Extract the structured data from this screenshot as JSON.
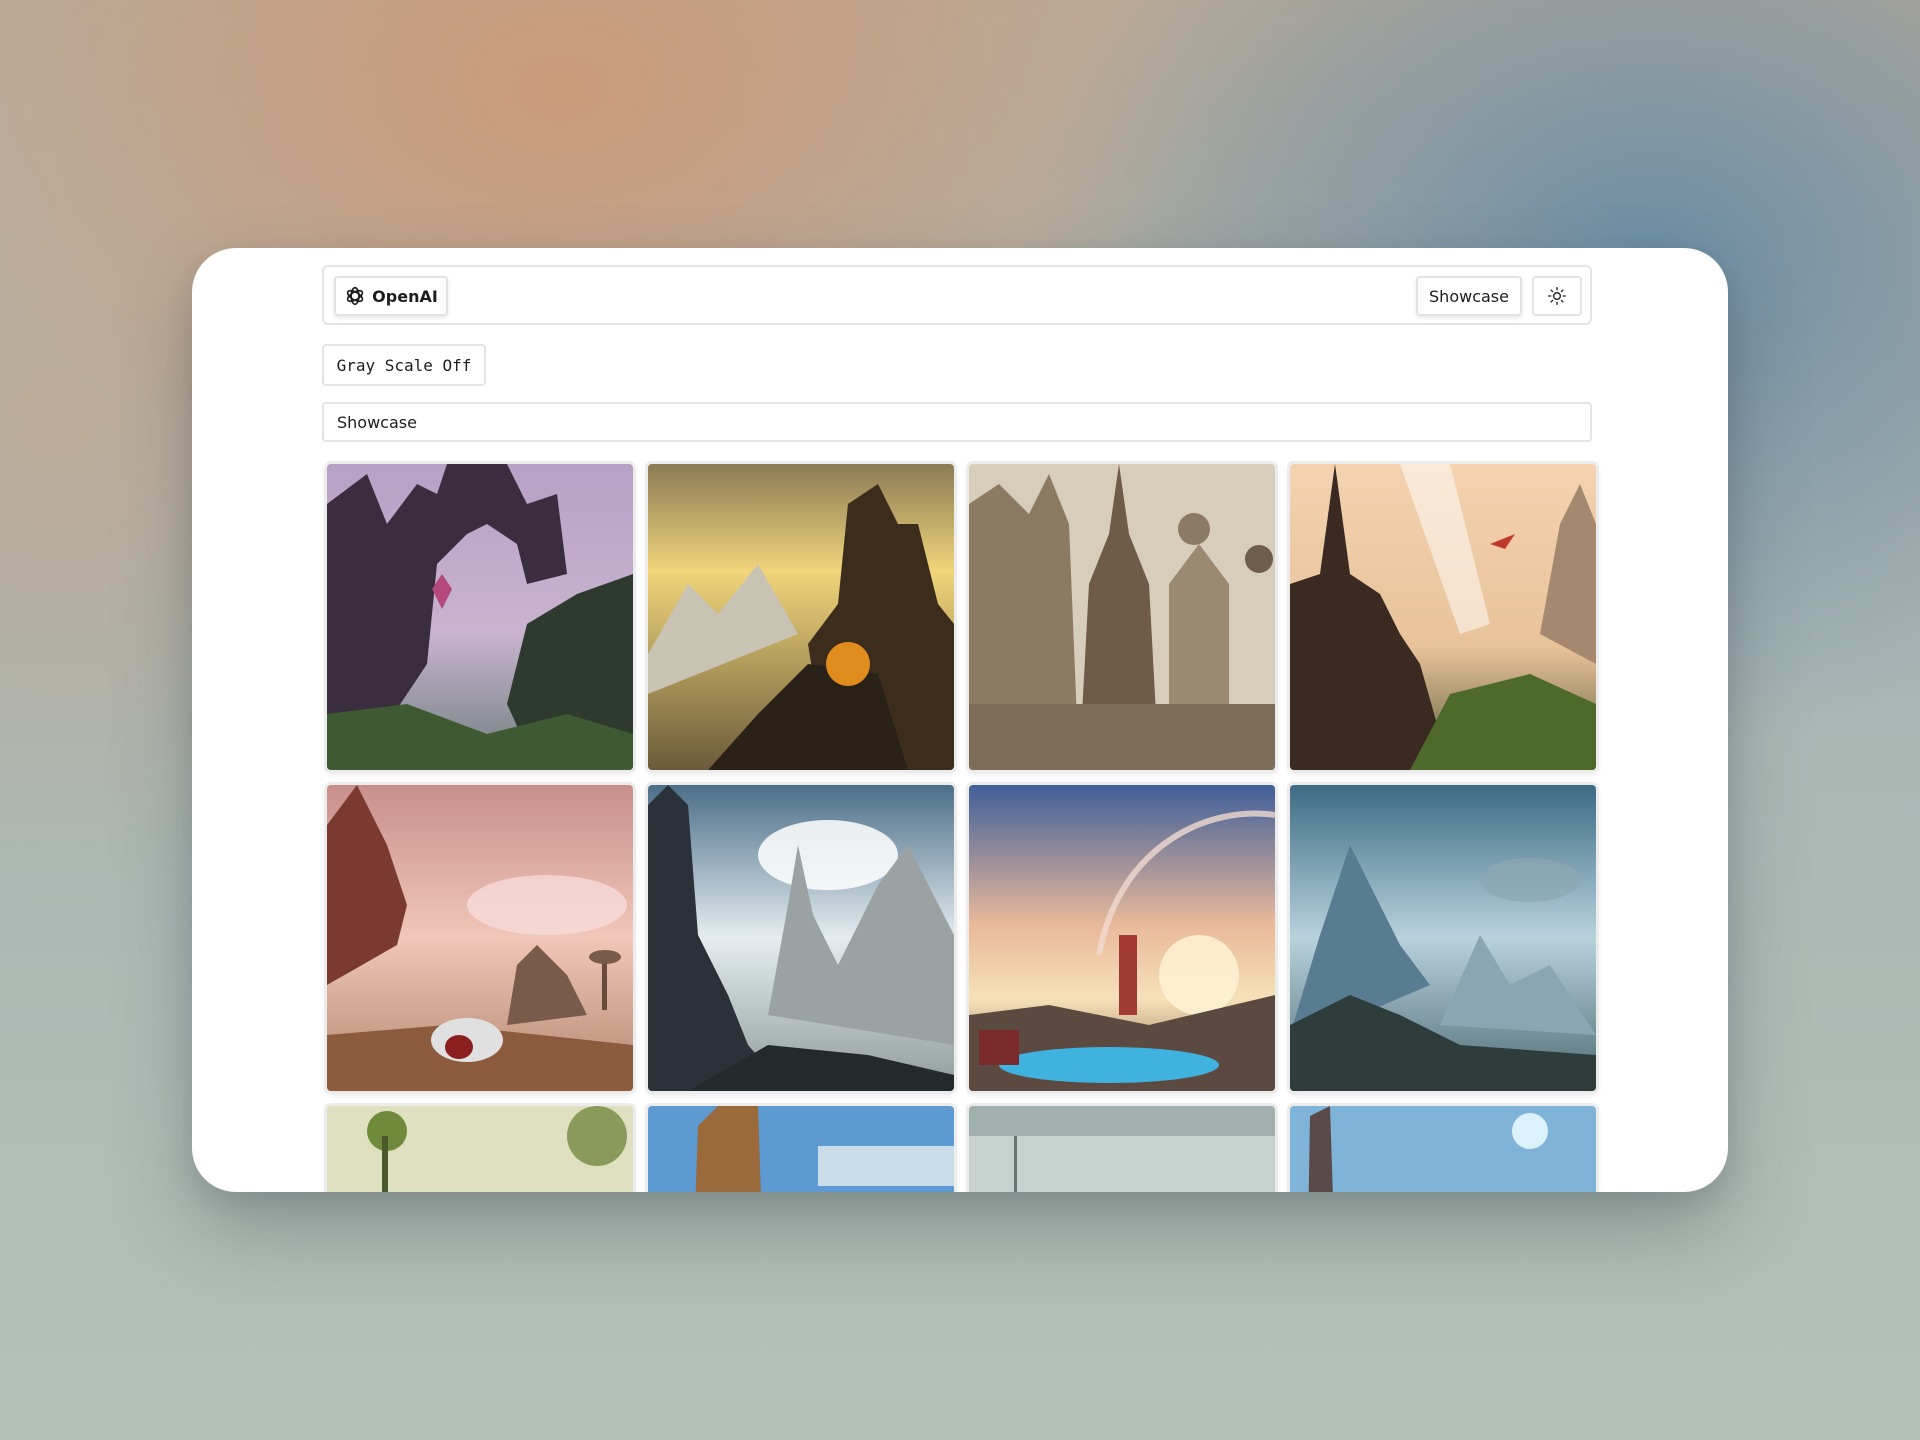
{
  "header": {
    "logo_label": "OpenAI",
    "nav_showcase_label": "Showcase",
    "theme_toggle_icon": "sun-icon"
  },
  "controls": {
    "grayscale_label": "Gray Scale Off"
  },
  "section": {
    "title": "Showcase"
  },
  "gallery": {
    "columns": 4,
    "image_count": 12,
    "subjects": [
      "dark arch castle with purple crystal",
      "golden mountain fortress with lava glow",
      "ornate steampunk city with airships",
      "ruined spires with light beam and red dragon",
      "pink sky with treehouse and mushroom towers",
      "dark tower with misty blue mountains",
      "sunset planet-ring over red tower and lake",
      "icy blue peaks with rocky shore",
      "green misty jungle",
      "blue sky with tall rock tower",
      "pale foggy plain",
      "ruined tower with glowing sky"
    ]
  }
}
